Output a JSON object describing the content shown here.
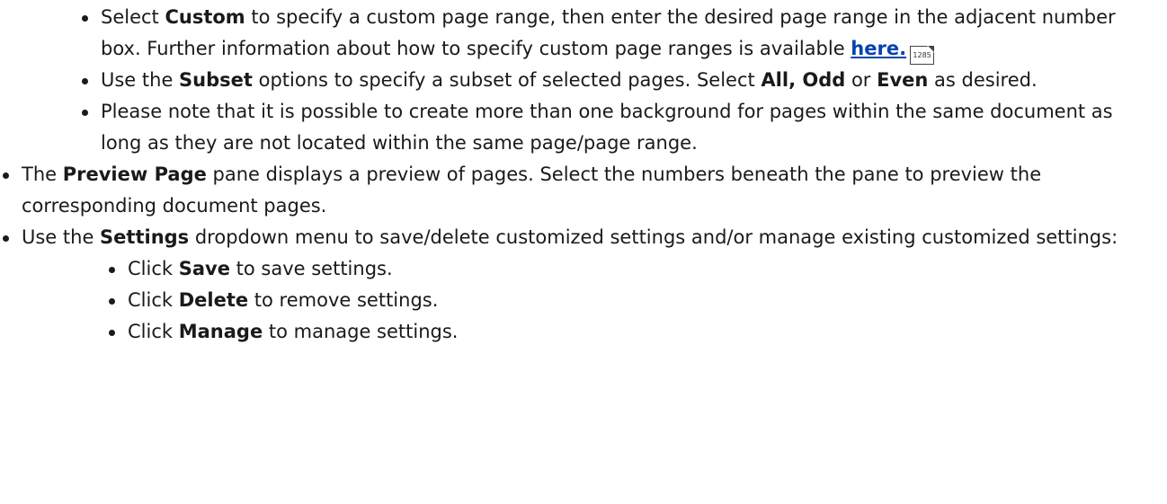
{
  "custom_item": {
    "t1": "Select ",
    "b1": "Custom",
    "t2": " to specify a custom page range, then enter the desired page range in the adjacent number box. Further information about how to specify custom page ranges is available ",
    "link": "here.",
    "page_ref": "1285"
  },
  "subset_item": {
    "t1": "Use the ",
    "b1": "Subset",
    "t2": " options to specify a subset of selected pages. Select ",
    "b2": "All, Odd",
    "t3": " or ",
    "b3": "Even",
    "t4": " as desired."
  },
  "note_item": {
    "t1": "Please note that it is possible to create more than one background for pages within the same document as long as they are not located within the same page/page range."
  },
  "preview_item": {
    "t1": "The ",
    "b1": "Preview Page",
    "t2": " pane displays a preview of pages. Select the numbers beneath the pane to preview the corresponding document pages."
  },
  "settings_item": {
    "t1": "Use the ",
    "b1": "Settings",
    "t2": " dropdown menu to save/delete customized settings and/or manage existing customized settings:"
  },
  "settings_sub": [
    {
      "t1": "Click ",
      "b1": "Save",
      "t2": " to save settings."
    },
    {
      "t1": "Click ",
      "b1": "Delete",
      "t2": " to remove settings."
    },
    {
      "t1": "Click ",
      "b1": "Manage",
      "t2": " to manage settings."
    }
  ]
}
